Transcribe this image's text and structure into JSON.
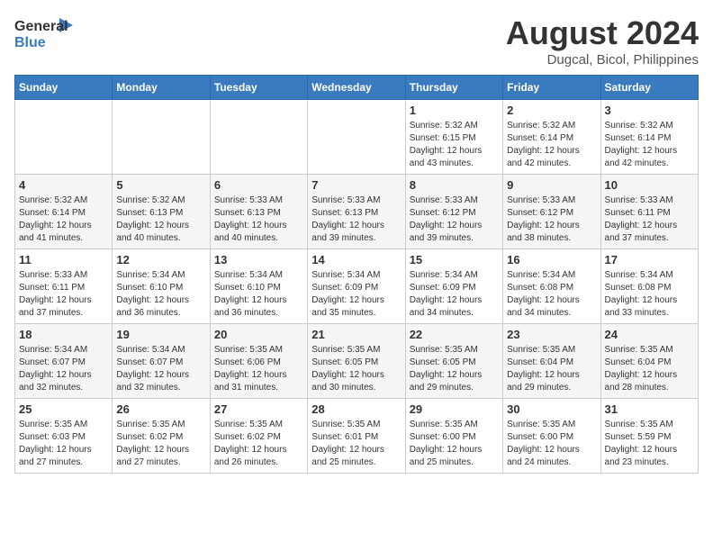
{
  "logo": {
    "line1": "General",
    "line2": "Blue"
  },
  "title": "August 2024",
  "subtitle": "Dugcal, Bicol, Philippines",
  "headers": [
    "Sunday",
    "Monday",
    "Tuesday",
    "Wednesday",
    "Thursday",
    "Friday",
    "Saturday"
  ],
  "weeks": [
    [
      {
        "date": "",
        "info": ""
      },
      {
        "date": "",
        "info": ""
      },
      {
        "date": "",
        "info": ""
      },
      {
        "date": "",
        "info": ""
      },
      {
        "date": "1",
        "info": "Sunrise: 5:32 AM\nSunset: 6:15 PM\nDaylight: 12 hours\nand 43 minutes."
      },
      {
        "date": "2",
        "info": "Sunrise: 5:32 AM\nSunset: 6:14 PM\nDaylight: 12 hours\nand 42 minutes."
      },
      {
        "date": "3",
        "info": "Sunrise: 5:32 AM\nSunset: 6:14 PM\nDaylight: 12 hours\nand 42 minutes."
      }
    ],
    [
      {
        "date": "4",
        "info": "Sunrise: 5:32 AM\nSunset: 6:14 PM\nDaylight: 12 hours\nand 41 minutes."
      },
      {
        "date": "5",
        "info": "Sunrise: 5:32 AM\nSunset: 6:13 PM\nDaylight: 12 hours\nand 40 minutes."
      },
      {
        "date": "6",
        "info": "Sunrise: 5:33 AM\nSunset: 6:13 PM\nDaylight: 12 hours\nand 40 minutes."
      },
      {
        "date": "7",
        "info": "Sunrise: 5:33 AM\nSunset: 6:13 PM\nDaylight: 12 hours\nand 39 minutes."
      },
      {
        "date": "8",
        "info": "Sunrise: 5:33 AM\nSunset: 6:12 PM\nDaylight: 12 hours\nand 39 minutes."
      },
      {
        "date": "9",
        "info": "Sunrise: 5:33 AM\nSunset: 6:12 PM\nDaylight: 12 hours\nand 38 minutes."
      },
      {
        "date": "10",
        "info": "Sunrise: 5:33 AM\nSunset: 6:11 PM\nDaylight: 12 hours\nand 37 minutes."
      }
    ],
    [
      {
        "date": "11",
        "info": "Sunrise: 5:33 AM\nSunset: 6:11 PM\nDaylight: 12 hours\nand 37 minutes."
      },
      {
        "date": "12",
        "info": "Sunrise: 5:34 AM\nSunset: 6:10 PM\nDaylight: 12 hours\nand 36 minutes."
      },
      {
        "date": "13",
        "info": "Sunrise: 5:34 AM\nSunset: 6:10 PM\nDaylight: 12 hours\nand 36 minutes."
      },
      {
        "date": "14",
        "info": "Sunrise: 5:34 AM\nSunset: 6:09 PM\nDaylight: 12 hours\nand 35 minutes."
      },
      {
        "date": "15",
        "info": "Sunrise: 5:34 AM\nSunset: 6:09 PM\nDaylight: 12 hours\nand 34 minutes."
      },
      {
        "date": "16",
        "info": "Sunrise: 5:34 AM\nSunset: 6:08 PM\nDaylight: 12 hours\nand 34 minutes."
      },
      {
        "date": "17",
        "info": "Sunrise: 5:34 AM\nSunset: 6:08 PM\nDaylight: 12 hours\nand 33 minutes."
      }
    ],
    [
      {
        "date": "18",
        "info": "Sunrise: 5:34 AM\nSunset: 6:07 PM\nDaylight: 12 hours\nand 32 minutes."
      },
      {
        "date": "19",
        "info": "Sunrise: 5:34 AM\nSunset: 6:07 PM\nDaylight: 12 hours\nand 32 minutes."
      },
      {
        "date": "20",
        "info": "Sunrise: 5:35 AM\nSunset: 6:06 PM\nDaylight: 12 hours\nand 31 minutes."
      },
      {
        "date": "21",
        "info": "Sunrise: 5:35 AM\nSunset: 6:05 PM\nDaylight: 12 hours\nand 30 minutes."
      },
      {
        "date": "22",
        "info": "Sunrise: 5:35 AM\nSunset: 6:05 PM\nDaylight: 12 hours\nand 29 minutes."
      },
      {
        "date": "23",
        "info": "Sunrise: 5:35 AM\nSunset: 6:04 PM\nDaylight: 12 hours\nand 29 minutes."
      },
      {
        "date": "24",
        "info": "Sunrise: 5:35 AM\nSunset: 6:04 PM\nDaylight: 12 hours\nand 28 minutes."
      }
    ],
    [
      {
        "date": "25",
        "info": "Sunrise: 5:35 AM\nSunset: 6:03 PM\nDaylight: 12 hours\nand 27 minutes."
      },
      {
        "date": "26",
        "info": "Sunrise: 5:35 AM\nSunset: 6:02 PM\nDaylight: 12 hours\nand 27 minutes."
      },
      {
        "date": "27",
        "info": "Sunrise: 5:35 AM\nSunset: 6:02 PM\nDaylight: 12 hours\nand 26 minutes."
      },
      {
        "date": "28",
        "info": "Sunrise: 5:35 AM\nSunset: 6:01 PM\nDaylight: 12 hours\nand 25 minutes."
      },
      {
        "date": "29",
        "info": "Sunrise: 5:35 AM\nSunset: 6:00 PM\nDaylight: 12 hours\nand 25 minutes."
      },
      {
        "date": "30",
        "info": "Sunrise: 5:35 AM\nSunset: 6:00 PM\nDaylight: 12 hours\nand 24 minutes."
      },
      {
        "date": "31",
        "info": "Sunrise: 5:35 AM\nSunset: 5:59 PM\nDaylight: 12 hours\nand 23 minutes."
      }
    ]
  ]
}
